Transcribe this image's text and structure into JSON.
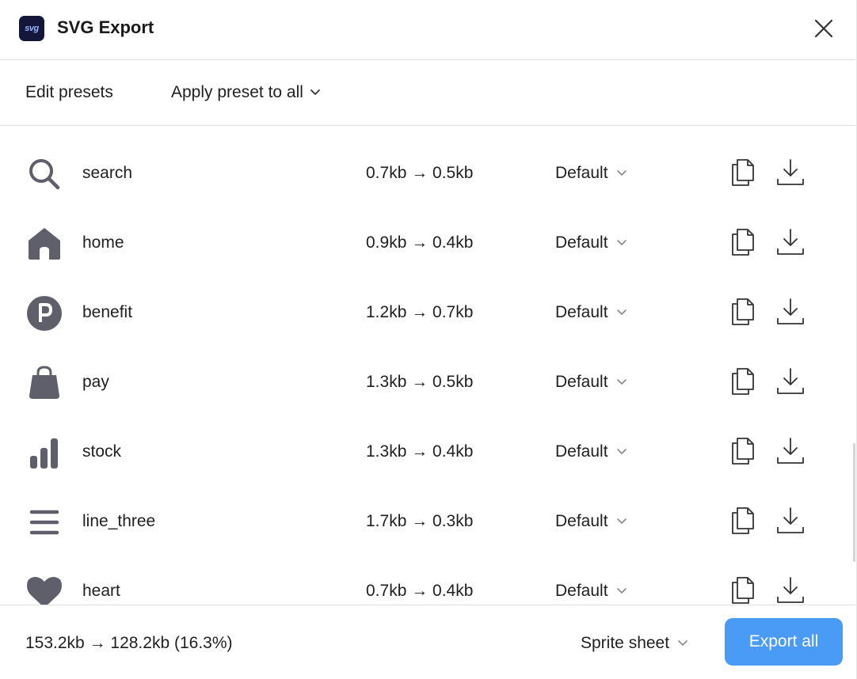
{
  "window": {
    "title": "SVG Export",
    "app_icon_text": "svg"
  },
  "toolbar": {
    "edit_presets_label": "Edit presets",
    "apply_preset_label": "Apply preset to all"
  },
  "rows": [
    {
      "icon": "search-icon",
      "name": "search",
      "size": "0.7kb → 0.5kb",
      "preset": "Default"
    },
    {
      "icon": "home-icon",
      "name": "home",
      "size": "0.9kb → 0.4kb",
      "preset": "Default"
    },
    {
      "icon": "parking-icon",
      "name": "benefit",
      "size": "1.2kb → 0.7kb",
      "preset": "Default"
    },
    {
      "icon": "shopping-bag-icon",
      "name": "pay",
      "size": "1.3kb → 0.5kb",
      "preset": "Default"
    },
    {
      "icon": "bar-chart-icon",
      "name": "stock",
      "size": "1.3kb → 0.4kb",
      "preset": "Default"
    },
    {
      "icon": "menu-lines-icon",
      "name": "line_three",
      "size": "1.7kb → 0.3kb",
      "preset": "Default"
    },
    {
      "icon": "heart-icon",
      "name": "heart",
      "size": "0.7kb → 0.4kb",
      "preset": "Default"
    }
  ],
  "footer": {
    "total": "153.2kb → 128.2kb (16.3%)",
    "mode_label": "Sprite sheet",
    "export_label": "Export all"
  },
  "colors": {
    "accent": "#4a9bf5",
    "icon_fill": "#5f5f6b",
    "app_icon_bg": "#15163a"
  }
}
